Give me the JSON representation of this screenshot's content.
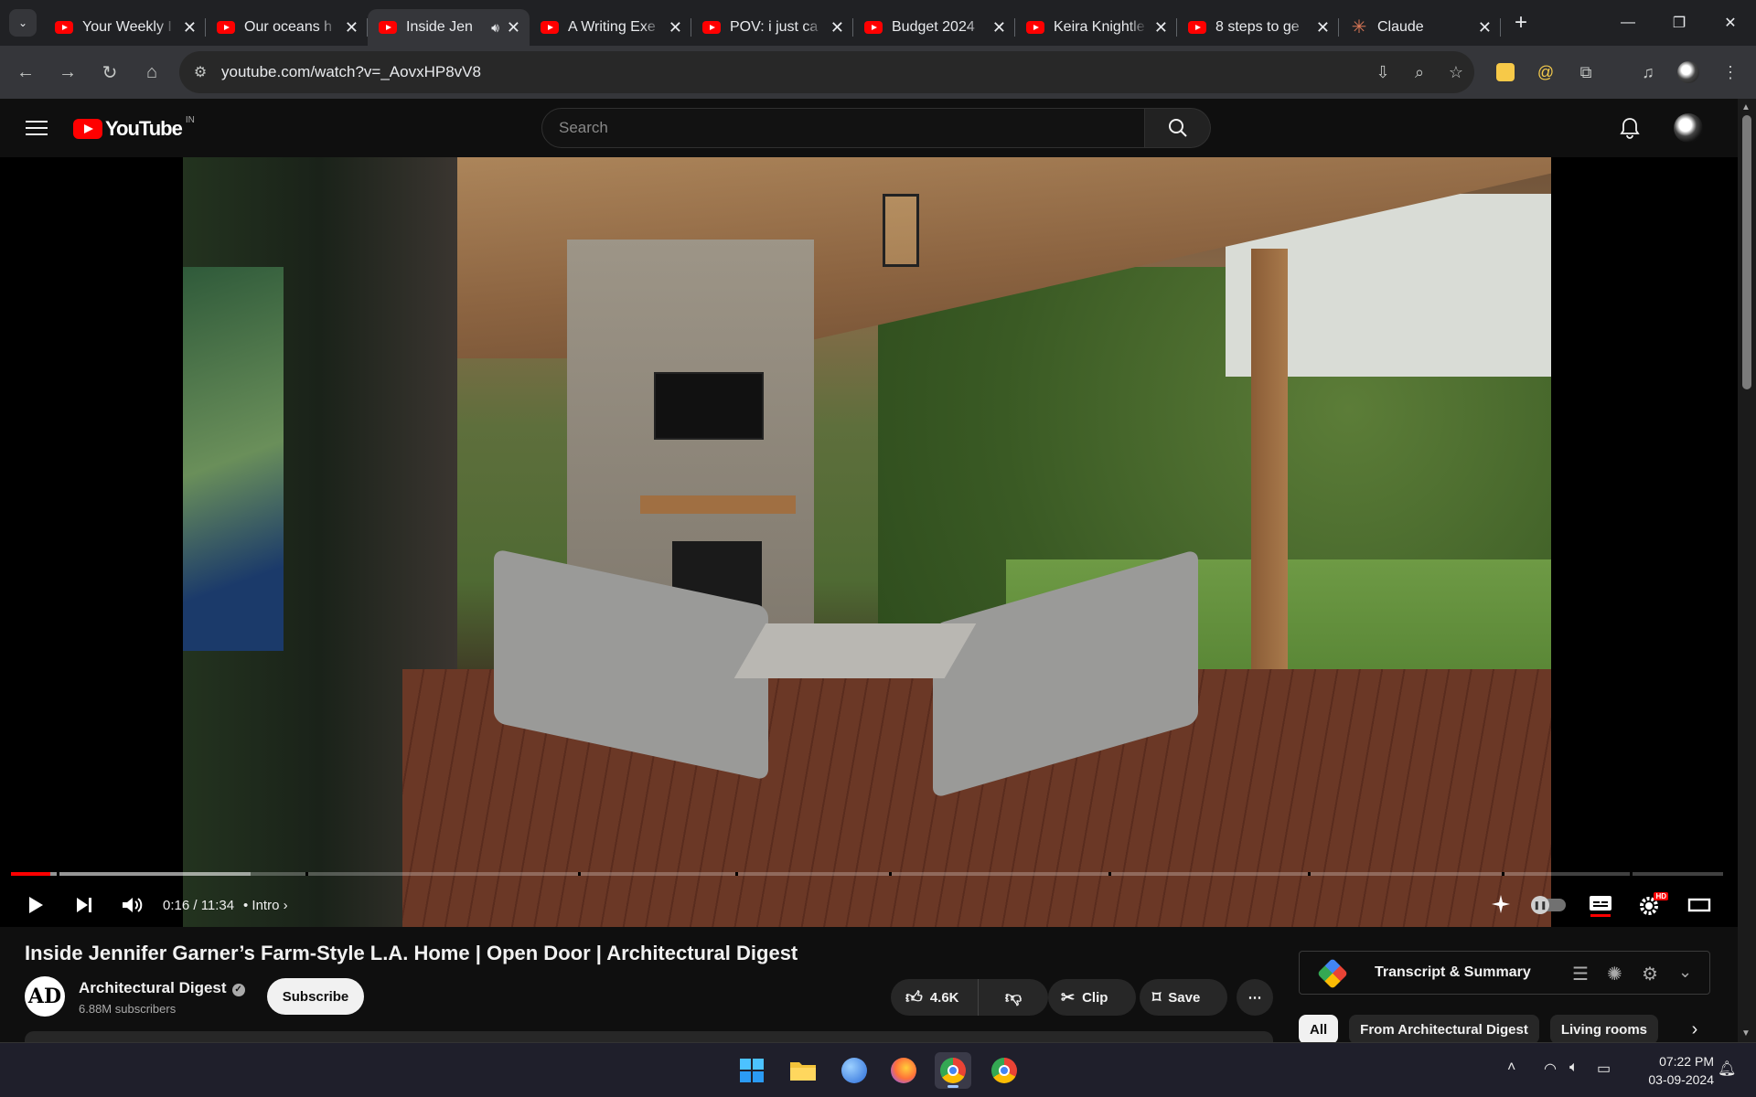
{
  "browser": {
    "tabs": [
      {
        "title": "Your Weekly I",
        "favicon": "youtube-icon",
        "active": false
      },
      {
        "title": "Our oceans h",
        "favicon": "youtube-icon",
        "active": false
      },
      {
        "title": "Inside Jen",
        "favicon": "youtube-icon",
        "active": true,
        "audio": true
      },
      {
        "title": "A Writing Exe",
        "favicon": "youtube-icon",
        "active": false
      },
      {
        "title": "POV: i just ca",
        "favicon": "youtube-icon",
        "active": false
      },
      {
        "title": "Budget 2024",
        "favicon": "youtube-icon",
        "active": false
      },
      {
        "title": "Keira Knightle",
        "favicon": "youtube-icon",
        "active": false
      },
      {
        "title": "8 steps to ge",
        "favicon": "youtube-icon",
        "active": false
      },
      {
        "title": "Claude",
        "favicon": "claude-icon",
        "active": false
      }
    ],
    "url": "youtube.com/watch?v=_AovxHP8vV8"
  },
  "youtube": {
    "logo_text": "YouTube",
    "country_code": "IN",
    "search_placeholder": "Search"
  },
  "player": {
    "current_time": "0:16",
    "duration": "11:34",
    "time_display": "0:16 / 11:34",
    "chapter": "Intro",
    "progress_played": 0.023,
    "progress_loaded": 0.14,
    "hd_badge": "HD"
  },
  "video": {
    "title": "Inside Jennifer Garner’s Farm-Style L.A. Home | Open Door | Architectural Digest",
    "channel": "Architectural Digest",
    "channel_initials": "AD",
    "subscribers": "6.88M subscribers",
    "subscribe_label": "Subscribe",
    "likes": "4.6K",
    "clip_label": "Clip",
    "save_label": "Save"
  },
  "sidebar": {
    "transcript_label": "Transcript & Summary",
    "chips": [
      "All",
      "From Architectural Digest",
      "Living rooms"
    ]
  },
  "taskbar": {
    "time": "07:22 PM",
    "date": "03-09-2024"
  },
  "colors": {
    "accent": "#ff0000",
    "background": "#0f0f0f",
    "chrome_frame": "#202124"
  }
}
